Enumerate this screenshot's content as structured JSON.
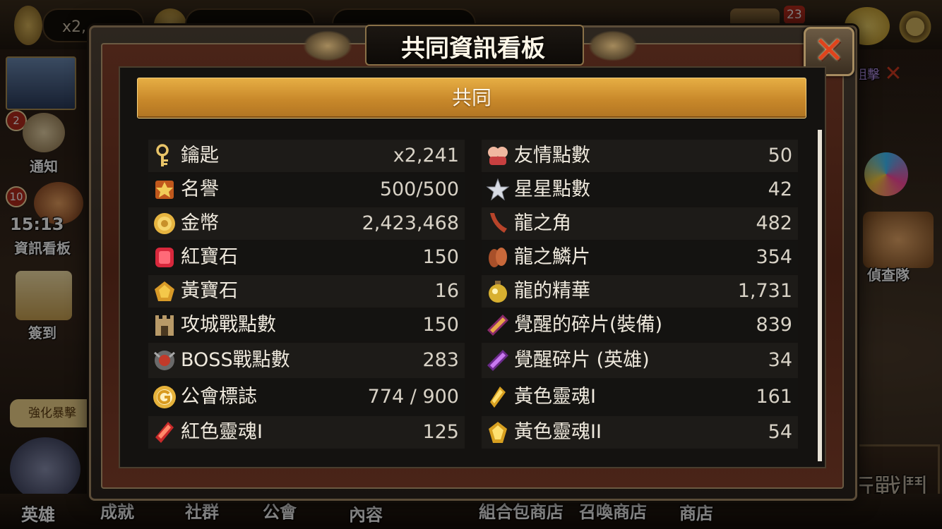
{
  "background": {
    "top_key_amount": "x2,",
    "mail_badge": "23",
    "left_menu": [
      {
        "label": "通知",
        "badge": "2"
      },
      {
        "label": "資訊看板",
        "badge": "10",
        "timer": "15:13"
      },
      {
        "label": "簽到"
      }
    ],
    "right_menu": [
      {
        "label": "偵查隊"
      }
    ],
    "right_partial_text": "阻擊",
    "tooltip": "強化暴擊",
    "fight_text": "行戰鬥",
    "bottom_nav": [
      "英雄",
      "成就",
      "社群",
      "公會",
      "內容",
      "組合包商店",
      "召喚商店",
      "商店"
    ]
  },
  "modal": {
    "title": "共同資訊看板",
    "tab": "共同",
    "close_icon": "close-x-icon"
  },
  "left_column": [
    {
      "icon": "key-icon",
      "label": "鑰匙",
      "value": "x2,241"
    },
    {
      "icon": "medal-icon",
      "label": "名譽",
      "value": "500/500"
    },
    {
      "icon": "gold-coin-icon",
      "label": "金幣",
      "value": "2,423,468"
    },
    {
      "icon": "red-gem-icon",
      "label": "紅寶石",
      "value": "150"
    },
    {
      "icon": "yellow-gem-icon",
      "label": "黃寶石",
      "value": "16"
    },
    {
      "icon": "castle-icon",
      "label": "攻城戰點數",
      "value": "150"
    },
    {
      "icon": "boss-icon",
      "label": "BOSS戰點數",
      "value": "283"
    },
    {
      "icon": "guild-emblem-icon",
      "label": "公會標誌",
      "value": "774 / 900"
    },
    {
      "icon": "red-soul-icon",
      "label": "紅色靈魂I",
      "value": "125"
    }
  ],
  "right_column": [
    {
      "icon": "friendship-icon",
      "label": "友情點數",
      "value": "50"
    },
    {
      "icon": "star-icon",
      "label": "星星點數",
      "value": "42"
    },
    {
      "icon": "dragon-horn-icon",
      "label": "龍之角",
      "value": "482"
    },
    {
      "icon": "dragon-scale-icon",
      "label": "龍之鱗片",
      "value": "354"
    },
    {
      "icon": "dragon-essence-icon",
      "label": "龍的精華",
      "value": "1,731"
    },
    {
      "icon": "equipment-shard-icon",
      "label": "覺醒的碎片(裝備)",
      "value": "839"
    },
    {
      "icon": "hero-shard-icon",
      "label": "覺醒碎片 (英雄)",
      "value": "34"
    },
    {
      "icon": "yellow-soul-icon",
      "label": "黃色靈魂I",
      "value": "161"
    },
    {
      "icon": "yellow-soul-2-icon",
      "label": "黃色靈魂II",
      "value": "54"
    }
  ],
  "colors": {
    "tab_gold": "#d69a34",
    "row_dark": "#1d1b18",
    "row_light": "#141311",
    "close_red": "#e0431c"
  }
}
